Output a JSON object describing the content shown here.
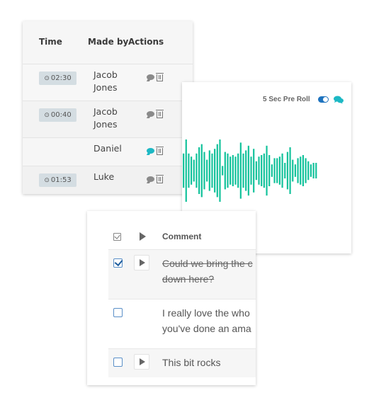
{
  "timeline_table": {
    "headers": {
      "time": "Time",
      "made_by": "Made by",
      "actions": "Actions"
    },
    "rows": [
      {
        "time": "02:30",
        "made_by": "Jacob Jones",
        "comment_active": false
      },
      {
        "time": "00:40",
        "made_by": "Jacob Jones",
        "comment_active": false
      },
      {
        "time": "",
        "made_by": "Daniel",
        "comment_active": true
      },
      {
        "time": "01:53",
        "made_by": "Luke",
        "comment_active": false
      }
    ],
    "icons": {
      "time": "clock-icon",
      "comment": "comment-icon",
      "delete": "trash-icon"
    }
  },
  "waveform_panel": {
    "preroll_label": "5 Sec Pre Roll",
    "preroll_enabled": true,
    "icons": {
      "toggle": "toggle-icon",
      "comments": "comments-icon"
    },
    "waveform_color": "#13c29b",
    "amplitudes": [
      0.55,
      1.0,
      0.55,
      0.45,
      0.35,
      0.55,
      0.75,
      0.85,
      0.6,
      0.35,
      0.65,
      0.55,
      0.7,
      0.85,
      1.0,
      0.15,
      0.6,
      0.55,
      0.45,
      0.5,
      0.45,
      0.55,
      0.9,
      0.55,
      0.65,
      0.8,
      0.45,
      0.7,
      0.3,
      0.45,
      0.5,
      0.55,
      0.8,
      0.5,
      0.2,
      0.4,
      0.4,
      0.45,
      0.55,
      0.25,
      0.6,
      0.75,
      0.35,
      0.2,
      0.4,
      0.45,
      0.5,
      0.4,
      0.3,
      0.2,
      0.25,
      0.25
    ],
    "accent_color": "#1e73be",
    "chat_color": "#1cb8c4"
  },
  "comments_table": {
    "headers": {
      "comment": "Comment"
    },
    "rows": [
      {
        "checked": true,
        "has_play": true,
        "text_line1": "Could we bring the c",
        "text_line2": "down here?",
        "resolved": true
      },
      {
        "checked": false,
        "has_play": false,
        "text_line1": "I really love the who",
        "text_line2": "you've done an ama",
        "resolved": false
      },
      {
        "checked": false,
        "has_play": true,
        "text_line1": "This bit rocks",
        "text_line2": "",
        "resolved": false
      }
    ]
  }
}
